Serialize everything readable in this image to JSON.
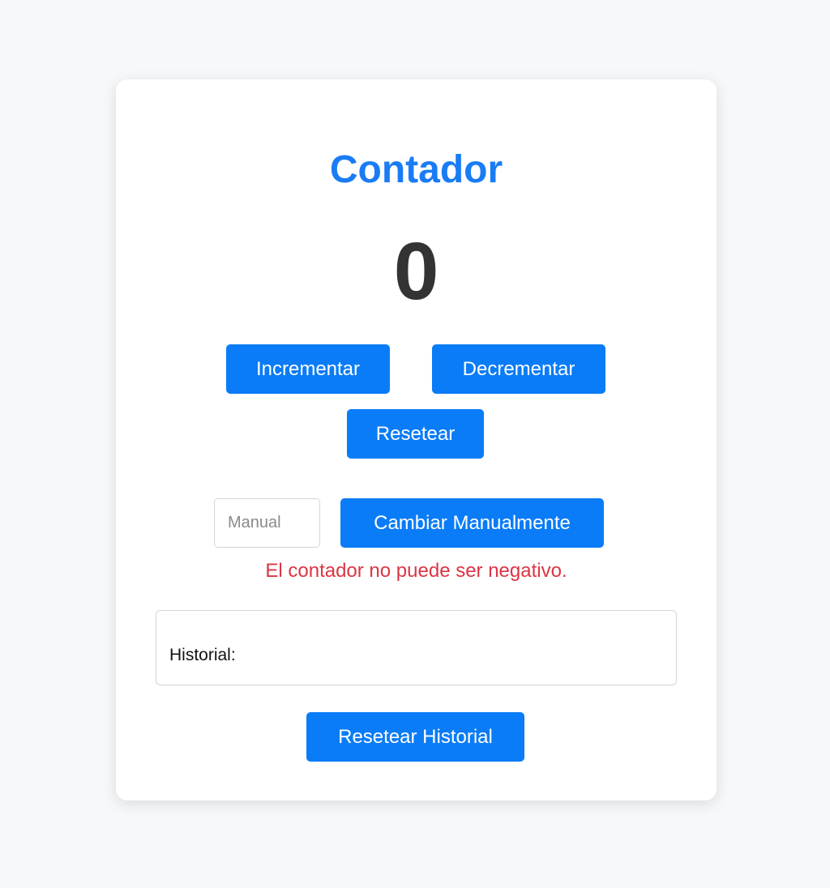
{
  "title": "Contador",
  "counter_value": "0",
  "buttons": {
    "increment": "Incrementar",
    "decrement": "Decrementar",
    "reset": "Resetear",
    "manual": "Cambiar Manualmente",
    "reset_history": "Resetear Historial"
  },
  "manual_input": {
    "placeholder": "Manual",
    "value": ""
  },
  "error_message": "El contador no puede ser negativo.",
  "history": {
    "label": "Historial:"
  },
  "colors": {
    "accent": "#1a7cf5",
    "button": "#0a7cf7",
    "error": "#dc3545",
    "background": "#f7f8fa"
  }
}
